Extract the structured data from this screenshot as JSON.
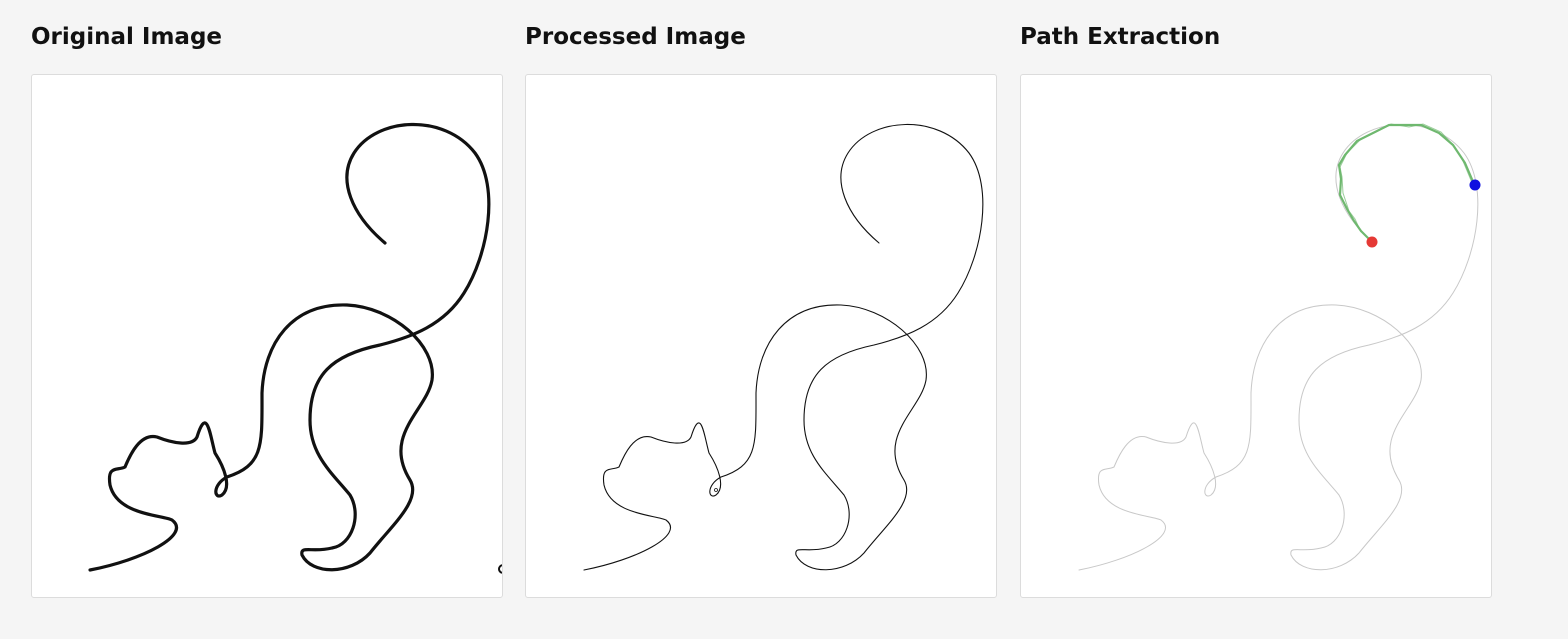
{
  "panels": [
    {
      "title": "Original Image"
    },
    {
      "title": "Processed Image"
    },
    {
      "title": "Path Extraction"
    }
  ],
  "colors": {
    "background": "#f5f5f5",
    "original_stroke": "#111111",
    "processed_stroke": "#111111",
    "faint_stroke": "#c8c8c8",
    "extracted_path": "#6fb86f",
    "start_point": "#e53935",
    "end_point": "#1010e0"
  }
}
